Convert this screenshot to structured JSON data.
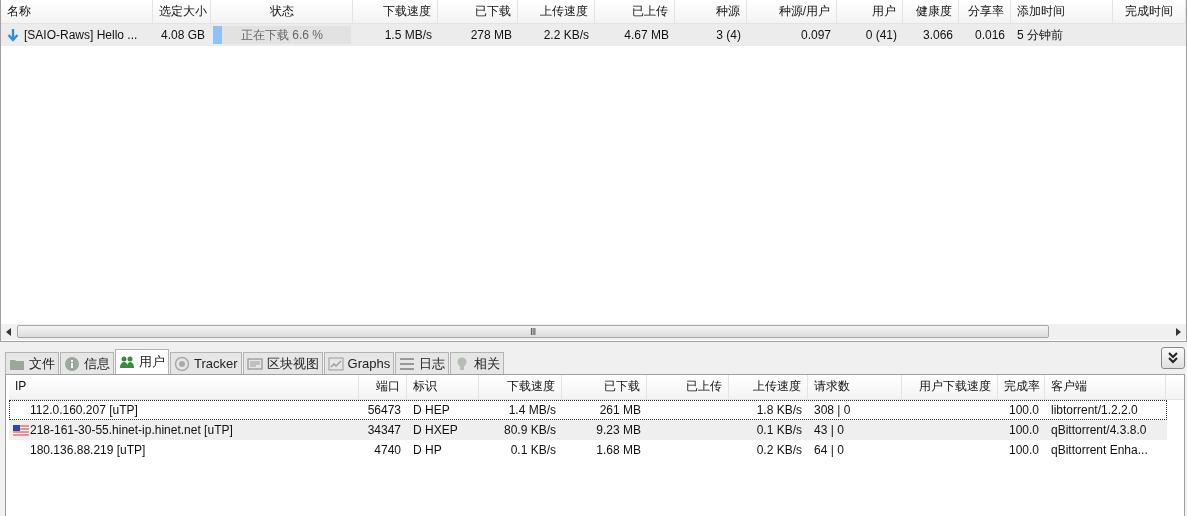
{
  "torrents": {
    "columns": [
      "名称",
      "选定大小",
      "状态",
      "下载速度",
      "已下载",
      "上传速度",
      "已上传",
      "种源",
      "种源/用户",
      "用户",
      "健康度",
      "分享率",
      "添加时间",
      "完成时间"
    ],
    "rows": [
      {
        "name": "[SAIO-Raws] Hello ...",
        "size": "4.08 GB",
        "status": "正在下载 6.6 %",
        "level": 0.066,
        "down_speed": "1.5 MB/s",
        "downloaded": "278 MB",
        "up_speed": "2.2 KB/s",
        "uploaded": "4.67 MB",
        "seeds": "3 (4)",
        "ratio_seeds": "0.097",
        "peers": "0 (41)",
        "health": "3.066",
        "share_ratio": "0.016",
        "added": "5 分钟前",
        "selected": true
      }
    ]
  },
  "scrollbar_grip": "Ⅲ",
  "tabs": [
    {
      "label": "文件",
      "kind": "files",
      "selected": false
    },
    {
      "label": "信息",
      "kind": "info",
      "selected": false
    },
    {
      "label": "用户",
      "kind": "peers",
      "selected": true
    },
    {
      "label": "Tracker",
      "kind": "tracker",
      "selected": false
    },
    {
      "label": "区块视图",
      "kind": "pieces",
      "selected": false
    },
    {
      "label": "Graphs",
      "kind": "graphs",
      "selected": false
    },
    {
      "label": "日志",
      "kind": "log",
      "selected": false
    },
    {
      "label": "相关",
      "kind": "related",
      "selected": false
    }
  ],
  "peers": {
    "columns": [
      "IP",
      "端口",
      "标识",
      "下载速度",
      "已下载",
      "已上传",
      "上传速度",
      "请求数",
      "用户下载速度",
      "完成率",
      "客户端"
    ],
    "rows": [
      {
        "ip": "112.0.160.207 [uTP]",
        "flag": false,
        "focused": true,
        "port": "56473",
        "flags": "D HEP",
        "down_speed": "1.4 MB/s",
        "downloaded": "261 MB",
        "up_speed": "1.8 KB/s",
        "requests": "308 | 0",
        "progress": "100.0",
        "client": "libtorrent/1.2.2.0"
      },
      {
        "ip": "218-161-30-55.hinet-ip.hinet.net [uTP]",
        "flag": true,
        "focused": false,
        "port": "34347",
        "flags": "D HXEP",
        "down_speed": "80.9 KB/s",
        "downloaded": "9.23 MB",
        "up_speed": "0.1 KB/s",
        "requests": "43 | 0",
        "progress": "100.0",
        "client": "qBittorrent/4.3.8.0"
      },
      {
        "ip": "180.136.88.219 [uTP]",
        "flag": false,
        "focused": false,
        "port": "4740",
        "flags": "D HP",
        "down_speed": "0.1 KB/s",
        "downloaded": "1.68 MB",
        "up_speed": "0.2 KB/s",
        "requests": "64 | 0",
        "progress": "100.0",
        "client": "qBittorrent Enha..."
      }
    ]
  }
}
